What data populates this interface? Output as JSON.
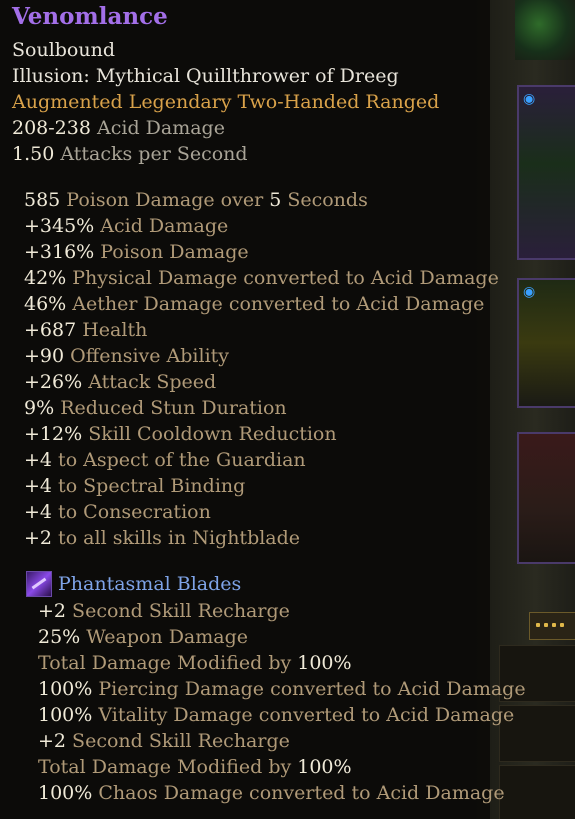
{
  "item": {
    "name": "Venomlance",
    "binding": "Soulbound",
    "illusion": "Illusion: Mythical Quillthrower of Dreeg",
    "type": "Augmented Legendary Two-Handed Ranged",
    "base_damage_value": "208-238",
    "base_damage_label": "Acid Damage",
    "attack_speed_value": "1.50",
    "attack_speed_label": "Attacks per Second"
  },
  "stats": [
    {
      "pre": "585",
      "desc": "Poison Damage over",
      "mid": "5",
      "post": "Seconds"
    },
    {
      "pre": "+345%",
      "desc": "Acid Damage"
    },
    {
      "pre": "+316%",
      "desc": "Poison Damage"
    },
    {
      "pre": "42%",
      "desc": "Physical Damage converted to Acid Damage"
    },
    {
      "pre": "46%",
      "desc": "Aether Damage converted to Acid Damage"
    },
    {
      "pre": "+687",
      "desc": "Health"
    },
    {
      "pre": "+90",
      "desc": "Offensive Ability"
    },
    {
      "pre": "+26%",
      "desc": "Attack Speed"
    },
    {
      "pre": "9%",
      "desc": "Reduced Stun Duration"
    },
    {
      "pre": "+12%",
      "desc": "Skill Cooldown Reduction"
    },
    {
      "pre": "+4",
      "desc": "to Aspect of the Guardian"
    },
    {
      "pre": "+4",
      "desc": "to Spectral Binding"
    },
    {
      "pre": "+4",
      "desc": "to Consecration"
    },
    {
      "pre": "+2",
      "desc": "to all skills in Nightblade"
    }
  ],
  "skill": {
    "name": "Phantasmal Blades",
    "icon": "phantasmal-blades-icon",
    "modifiers": [
      {
        "pre": "+2",
        "desc": "Second Skill Recharge"
      },
      {
        "pre": "25%",
        "desc": "Weapon Damage"
      },
      {
        "pre": "",
        "desc": "Total Damage Modified by",
        "post": "100%"
      },
      {
        "pre": "100%",
        "desc": "Piercing Damage converted to Acid Damage"
      },
      {
        "pre": "100%",
        "desc": "Vitality Damage converted to Acid Damage"
      },
      {
        "pre": "+2",
        "desc": "Second Skill Recharge"
      },
      {
        "pre": "",
        "desc": "Total Damage Modified by",
        "post": "100%"
      },
      {
        "pre": "100%",
        "desc": "Chaos Damage converted to Acid Damage"
      }
    ]
  },
  "colors": {
    "legendary_name": "#a36fe8",
    "item_type": "#d9a24a",
    "skill_name": "#7fa4e8",
    "stat_desc": "#b09a78"
  }
}
